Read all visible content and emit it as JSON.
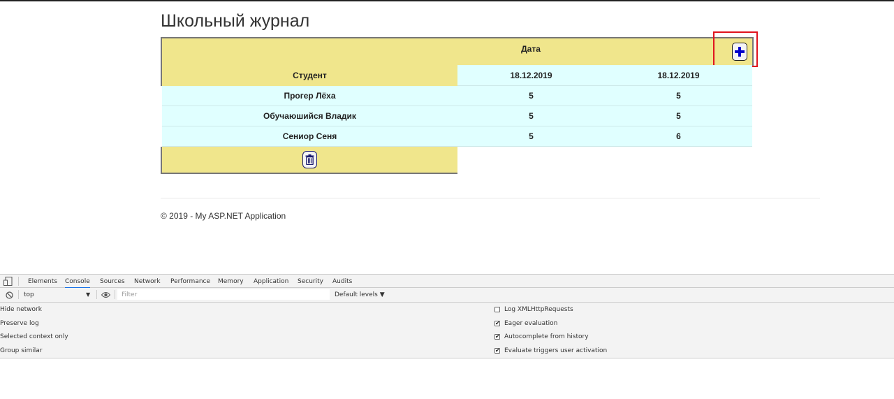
{
  "page": {
    "title": "Школьный журнал",
    "footer": "© 2019 - My ASP.NET Application"
  },
  "journal": {
    "date_header": "Дата",
    "student_header": "Студент",
    "dates": [
      "18.12.2019",
      "18.12.2019"
    ],
    "rows": [
      {
        "name": "Прогер Лёха",
        "grades": [
          "5",
          "5"
        ]
      },
      {
        "name": "Обучаюшийся Владик",
        "grades": [
          "5",
          "5"
        ]
      },
      {
        "name": "Сениор Сеня",
        "grades": [
          "5",
          "6"
        ]
      }
    ],
    "add_icon": "plus-icon",
    "delete_icon": "trash-icon"
  },
  "devtools": {
    "tabs": [
      "Elements",
      "Console",
      "Sources",
      "Network",
      "Performance",
      "Memory",
      "Application",
      "Security",
      "Audits"
    ],
    "active_tab": "Console",
    "context": "top",
    "filter_placeholder": "Filter",
    "levels": "Default levels ▼",
    "left_settings": [
      "Hide network",
      "Preserve log",
      "Selected context only",
      "Group similar"
    ],
    "right_settings": [
      {
        "label": "Log XMLHttpRequests",
        "checked": false
      },
      {
        "label": "Eager evaluation",
        "checked": true
      },
      {
        "label": "Autocomplete from history",
        "checked": true
      },
      {
        "label": "Evaluate triggers user activation",
        "checked": true
      }
    ]
  },
  "colors": {
    "header_bg": "#f0e68c",
    "cell_bg": "#e0ffff",
    "highlight": "#e0141e",
    "add_icon": "#0000cc"
  }
}
